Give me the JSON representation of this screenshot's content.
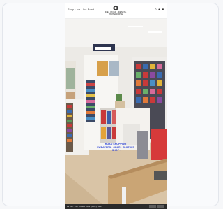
{
  "header": {
    "nav_text": "Shop · Ice · Ice Road",
    "logo_text_line1": "ICE · ROAD · DENTAL",
    "logo_text_line2": "WHITEHORSE",
    "icons": [
      "search-icon",
      "user-icon",
      "bag-icon"
    ]
  },
  "hero": {
    "overlay_lines": [
      "ROAD SHOPPING",
      "SWEATERS · GEAR · CLOTHES",
      "· SHOP ·"
    ]
  },
  "footer": {
    "text": "Ice road · shop · cookies notice · privacy · terms"
  },
  "colors": {
    "overlay_text": "#2d44d6",
    "footer_bg": "#2b2b2b"
  }
}
